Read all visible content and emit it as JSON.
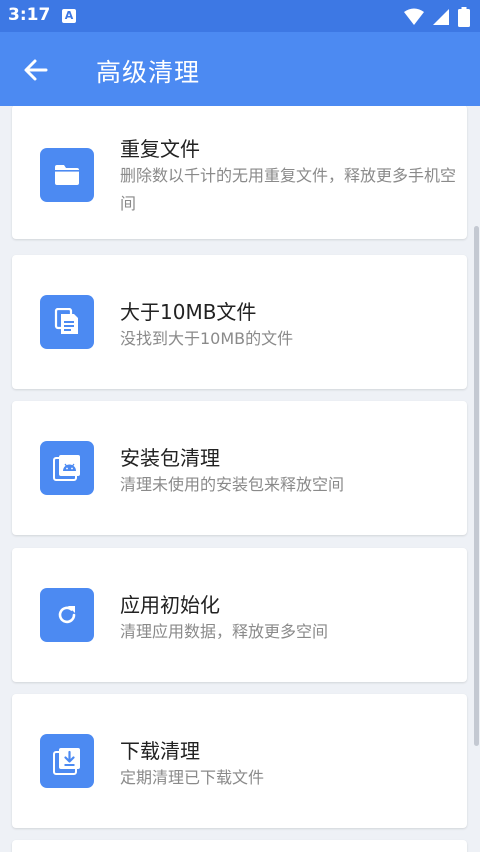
{
  "status_bar": {
    "time": "3:17",
    "notif_letter": "A"
  },
  "app_bar": {
    "title": "高级清理"
  },
  "items": [
    {
      "title": "重复文件",
      "desc": "删除数以千计的无用重复文件，释放更多手机空间",
      "icon": "folder-icon"
    },
    {
      "title": "大于10MB文件",
      "desc": "没找到大于10MB的文件",
      "icon": "document-icon"
    },
    {
      "title": "安装包清理",
      "desc": "清理未使用的安装包来释放空间",
      "icon": "apk-icon"
    },
    {
      "title": "应用初始化",
      "desc": "清理应用数据，释放更多空间",
      "icon": "refresh-icon"
    },
    {
      "title": "下载清理",
      "desc": "定期清理已下载文件",
      "icon": "download-icon"
    }
  ],
  "colors": {
    "accent": "#4c8af2",
    "status": "#3d78e4",
    "background": "#eef1f6"
  }
}
